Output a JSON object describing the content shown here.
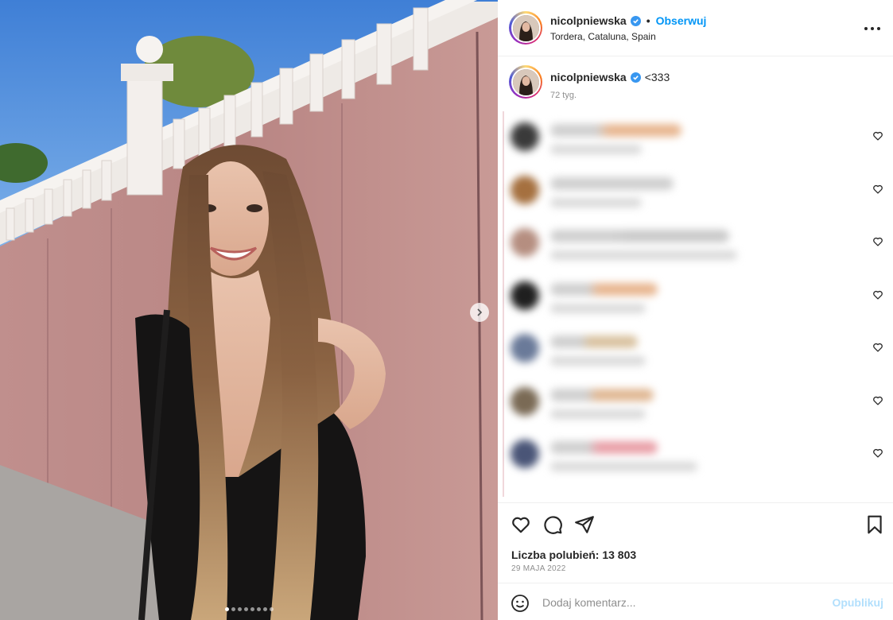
{
  "post": {
    "username": "nicolpniewska",
    "follow_label": "Obserwuj",
    "separator": "•",
    "location": "Tordera, Cataluna, Spain",
    "verified_icon": "verified-badge-icon",
    "more_icon": "more-options-icon"
  },
  "caption": {
    "username": "nicolpniewska",
    "text": "<333",
    "time": "72 tyg."
  },
  "comments": [
    {
      "avatar_color": "#3a3a3a",
      "line1_w": 165,
      "line1_color": "#e8b690",
      "line2_w": 115
    },
    {
      "avatar_color": "#a5703f",
      "line1_w": 155,
      "line1_color": "#cfcfcf",
      "line2_w": 115
    },
    {
      "avatar_color": "#b58e80",
      "line1_w": 225,
      "line1_color": "#c9c9c9",
      "line2_w": 235
    },
    {
      "avatar_color": "#1f1f1f",
      "line1_w": 135,
      "line1_color": "#e8b690",
      "line2_w": 120
    },
    {
      "avatar_color": "#6a7a99",
      "line1_w": 110,
      "line1_color": "#d9c2a0",
      "line2_w": 120
    },
    {
      "avatar_color": "#7a6a55",
      "line1_w": 130,
      "line1_color": "#e0b894",
      "line2_w": 120
    },
    {
      "avatar_color": "#4a5577",
      "line1_w": 135,
      "line1_color": "#e9a0a8",
      "line2_w": 185
    }
  ],
  "actions": {
    "like_icon": "heart-icon",
    "comment_icon": "comment-icon",
    "share_icon": "share-icon",
    "save_icon": "bookmark-icon",
    "likes_text": "Liczba polubień: 13 803",
    "date": "29 MAJA 2022"
  },
  "add_comment": {
    "placeholder": "Dodaj komentarz...",
    "post_label": "Opublikuj",
    "emoji_icon": "emoji-icon"
  },
  "carousel": {
    "slide_count": 8,
    "active_index": 0,
    "next_icon": "chevron-right-icon"
  },
  "colors": {
    "accent": "#0095f6",
    "verified": "#3897f0",
    "post_disabled": "#b2dffc"
  }
}
